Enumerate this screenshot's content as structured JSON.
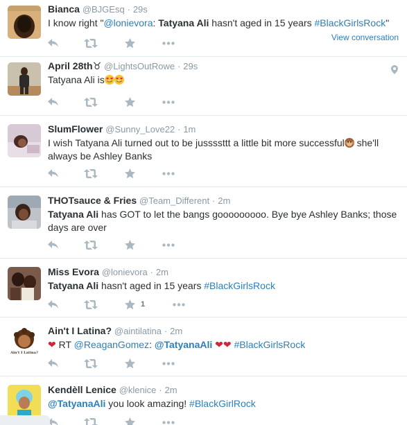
{
  "tweets": [
    {
      "name": "Bianca",
      "handle": "@BJGEsq",
      "time": "29s",
      "text_parts": [
        {
          "t": "I know right \"",
          "s": "plain"
        },
        {
          "t": "@lonievora",
          "s": "link"
        },
        {
          "t": ": ",
          "s": "plain"
        },
        {
          "t": "Tatyana Ali",
          "s": "bold"
        },
        {
          "t": " hasn't aged in 15 years ",
          "s": "plain"
        },
        {
          "t": "#BlackGirlsRock",
          "s": "link"
        },
        {
          "t": "\"",
          "s": "plain"
        }
      ],
      "view_conversation": "View conversation"
    },
    {
      "name": "April 28th",
      "name_suffix": "♉",
      "handle": "@LightsOutRowe",
      "time": "29s",
      "text_parts": [
        {
          "t": "Tatyana Ali is",
          "s": "plain"
        },
        {
          "t": "heart-eyes",
          "s": "emoji"
        },
        {
          "t": "heart-eyes",
          "s": "emoji"
        }
      ],
      "has_geo": true
    },
    {
      "name": "SlumFlower",
      "handle": "@Sunny_Love22",
      "time": "1m",
      "text_parts": [
        {
          "t": "I wish Tatyana Ali turned out to be jussssttt a little bit more successful",
          "s": "plain"
        },
        {
          "t": "monkey-face",
          "s": "emoji"
        },
        {
          "t": " she'll always be Ashley Banks",
          "s": "plain"
        }
      ]
    },
    {
      "name": "THOTsauce & Fries",
      "handle": "@Team_Different",
      "time": "2m",
      "text_parts": [
        {
          "t": "Tatyana Ali",
          "s": "bold"
        },
        {
          "t": " has GOT to let the bangs gooooooooo. Bye bye Ashley Banks; those days are over",
          "s": "plain"
        }
      ]
    },
    {
      "name": "Miss Evora",
      "handle": "@lonievora",
      "time": "2m",
      "text_parts": [
        {
          "t": "Tatyana Ali",
          "s": "bold"
        },
        {
          "t": " hasn't aged in 15 years ",
          "s": "plain"
        },
        {
          "t": "#BlackGirlsRock",
          "s": "link"
        }
      ],
      "favorite_count": "1"
    },
    {
      "name": "Ain't I Latina?",
      "handle": "@aintilatina",
      "time": "2m",
      "avatar_caption": "Ain't I Latina?",
      "text_parts": [
        {
          "t": "❤",
          "s": "heart"
        },
        {
          "t": " RT ",
          "s": "plain"
        },
        {
          "t": "@ReaganGomez",
          "s": "link"
        },
        {
          "t": ": ",
          "s": "plain"
        },
        {
          "t": "@TatyanaAli",
          "s": "linkbold"
        },
        {
          "t": " ",
          "s": "plain"
        },
        {
          "t": "❤❤",
          "s": "heart"
        },
        {
          "t": " ",
          "s": "plain"
        },
        {
          "t": "#BlackGirlsRock",
          "s": "link"
        }
      ]
    },
    {
      "name": "Kendèll Lenice",
      "handle": "@klenice",
      "time": "2m",
      "text_parts": [
        {
          "t": "@TatyanaAli",
          "s": "linkbold"
        },
        {
          "t": " you look amazing! ",
          "s": "plain"
        },
        {
          "t": "#BlackGirlRock",
          "s": "link"
        }
      ]
    }
  ],
  "icons": {
    "reply": "reply-icon",
    "retweet": "retweet-icon",
    "favorite": "star-icon",
    "more": "more-icon",
    "geo": "location-pin-icon"
  },
  "colors": {
    "link": "#2a7fbd",
    "meta": "#8899a6",
    "action": "#aab8c2",
    "divider": "#e1e8ed"
  }
}
